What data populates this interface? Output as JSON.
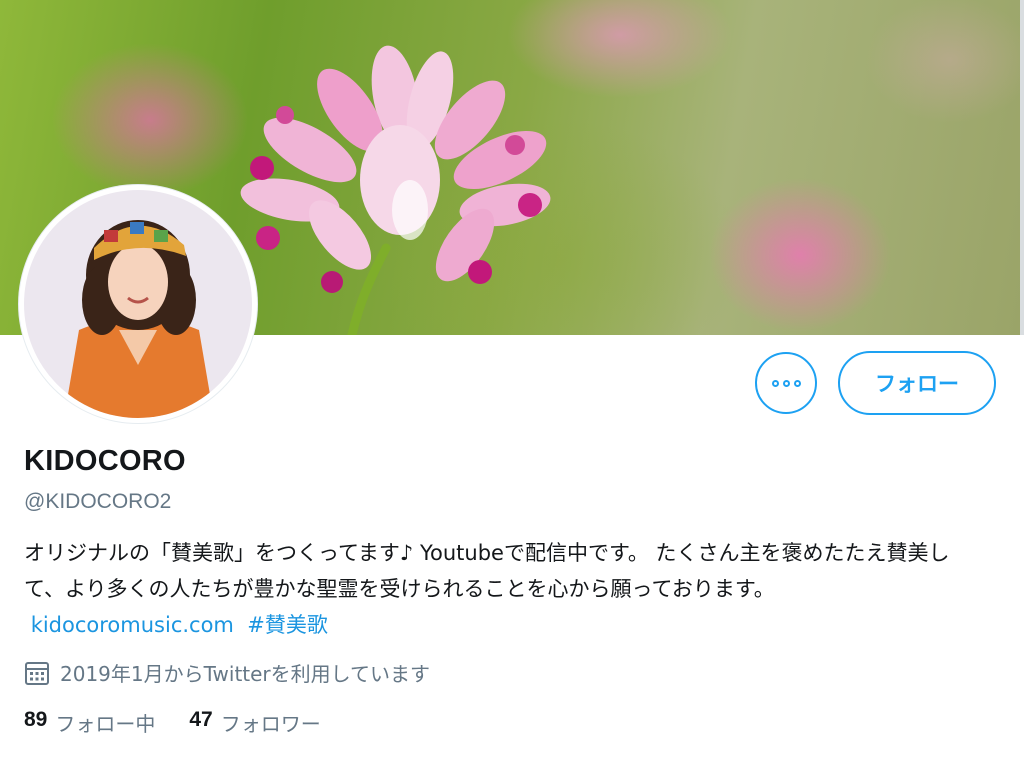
{
  "profile": {
    "display_name": "KIDOCORO",
    "handle": "@KIDOCORO2",
    "bio_text": "オリジナルの「賛美歌」をつくってます♪ Youtubeで配信中です。 たくさん主を褒めたたえ賛美して、より多くの人たちが豊かな聖霊を受けられることを心から願っております。",
    "bio_link": "kidocoromusic.com",
    "bio_hashtag": "#賛美歌",
    "joined": "2019年1月からTwitterを利用しています"
  },
  "actions": {
    "more_icon": "more-horizontal-icon",
    "follow_label": "フォロー"
  },
  "stats": {
    "following_count": "89",
    "following_label": "フォロー中",
    "followers_count": "47",
    "followers_label": "フォロワー"
  },
  "icons": {
    "calendar": "calendar-icon"
  },
  "colors": {
    "accent": "#1da1f2",
    "link": "#1b95e0",
    "secondary_text": "#657786",
    "primary_text": "#14171a"
  }
}
